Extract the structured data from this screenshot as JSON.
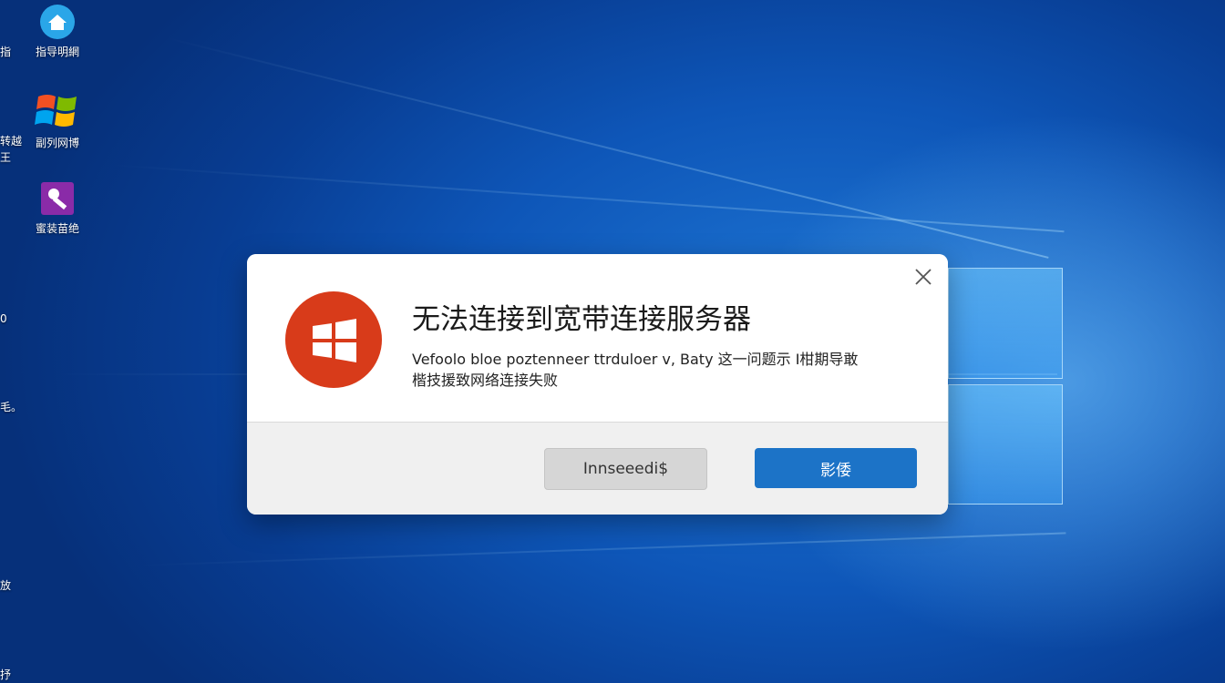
{
  "desktop": {
    "icons": [
      {
        "name": "network-icon",
        "label": "指导明網"
      },
      {
        "name": "windows-icon",
        "label": "副列网博"
      },
      {
        "name": "tools-icon",
        "label": "蜜装苗绝"
      }
    ],
    "edge_labels": [
      "指",
      "转越",
      "王",
      "0",
      "毛。",
      "放",
      "抒"
    ]
  },
  "dialog": {
    "title": "无法连接到宽带连接服务器",
    "message_line1": "Vefoolo bloe poztenneer ttrduloer v, Baty 这一问题示 I柑期导敢",
    "message_line2": "楷技援致网络连接失败",
    "secondary_button": "Innseeedi$",
    "primary_button": "影倭",
    "colors": {
      "error": "#d83b1a",
      "primary": "#1c73c7"
    }
  }
}
